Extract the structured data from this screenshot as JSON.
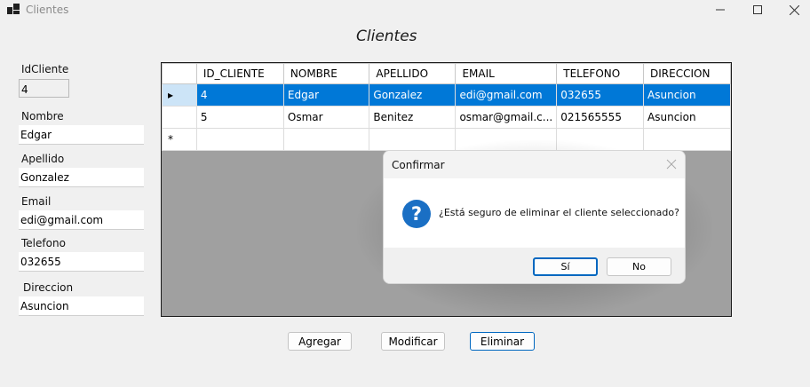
{
  "window": {
    "title": "Clientes",
    "icon": "app-window-icon"
  },
  "form": {
    "title": "Clientes"
  },
  "fields": {
    "id": {
      "label": "IdCliente",
      "value": "4"
    },
    "nombre": {
      "label": "Nombre",
      "value": "Edgar"
    },
    "apellido": {
      "label": "Apellido",
      "value": "Gonzalez"
    },
    "email": {
      "label": "Email",
      "value": "edi@gmail.com"
    },
    "telefono": {
      "label": "Telefono",
      "value": "032655"
    },
    "direccion": {
      "label": "Direccion",
      "value": "Asuncion"
    }
  },
  "grid": {
    "columns": [
      "ID_CLIENTE",
      "NOMBRE",
      "APELLIDO",
      "EMAIL",
      "TELEFONO",
      "DIRECCION"
    ],
    "rows": [
      [
        "4",
        "Edgar",
        "Gonzalez",
        "edi@gmail.com",
        "032655",
        "Asuncion"
      ],
      [
        "5",
        "Osmar",
        "Benitez",
        "osmar@gmail.c...",
        "021565555",
        "Asuncion"
      ]
    ],
    "selected_marker": "▸",
    "new_row_marker": "*",
    "selected_color": "#0078d7"
  },
  "buttons": {
    "agregar": "Agregar",
    "modificar": "Modificar",
    "eliminar": "Eliminar"
  },
  "dialog": {
    "title": "Confirmar",
    "message": "¿Está seguro de eliminar el cliente seleccionado?",
    "icon_glyph": "?",
    "yes": "Sí",
    "no": "No",
    "icon_color": "#1a6fc4"
  }
}
